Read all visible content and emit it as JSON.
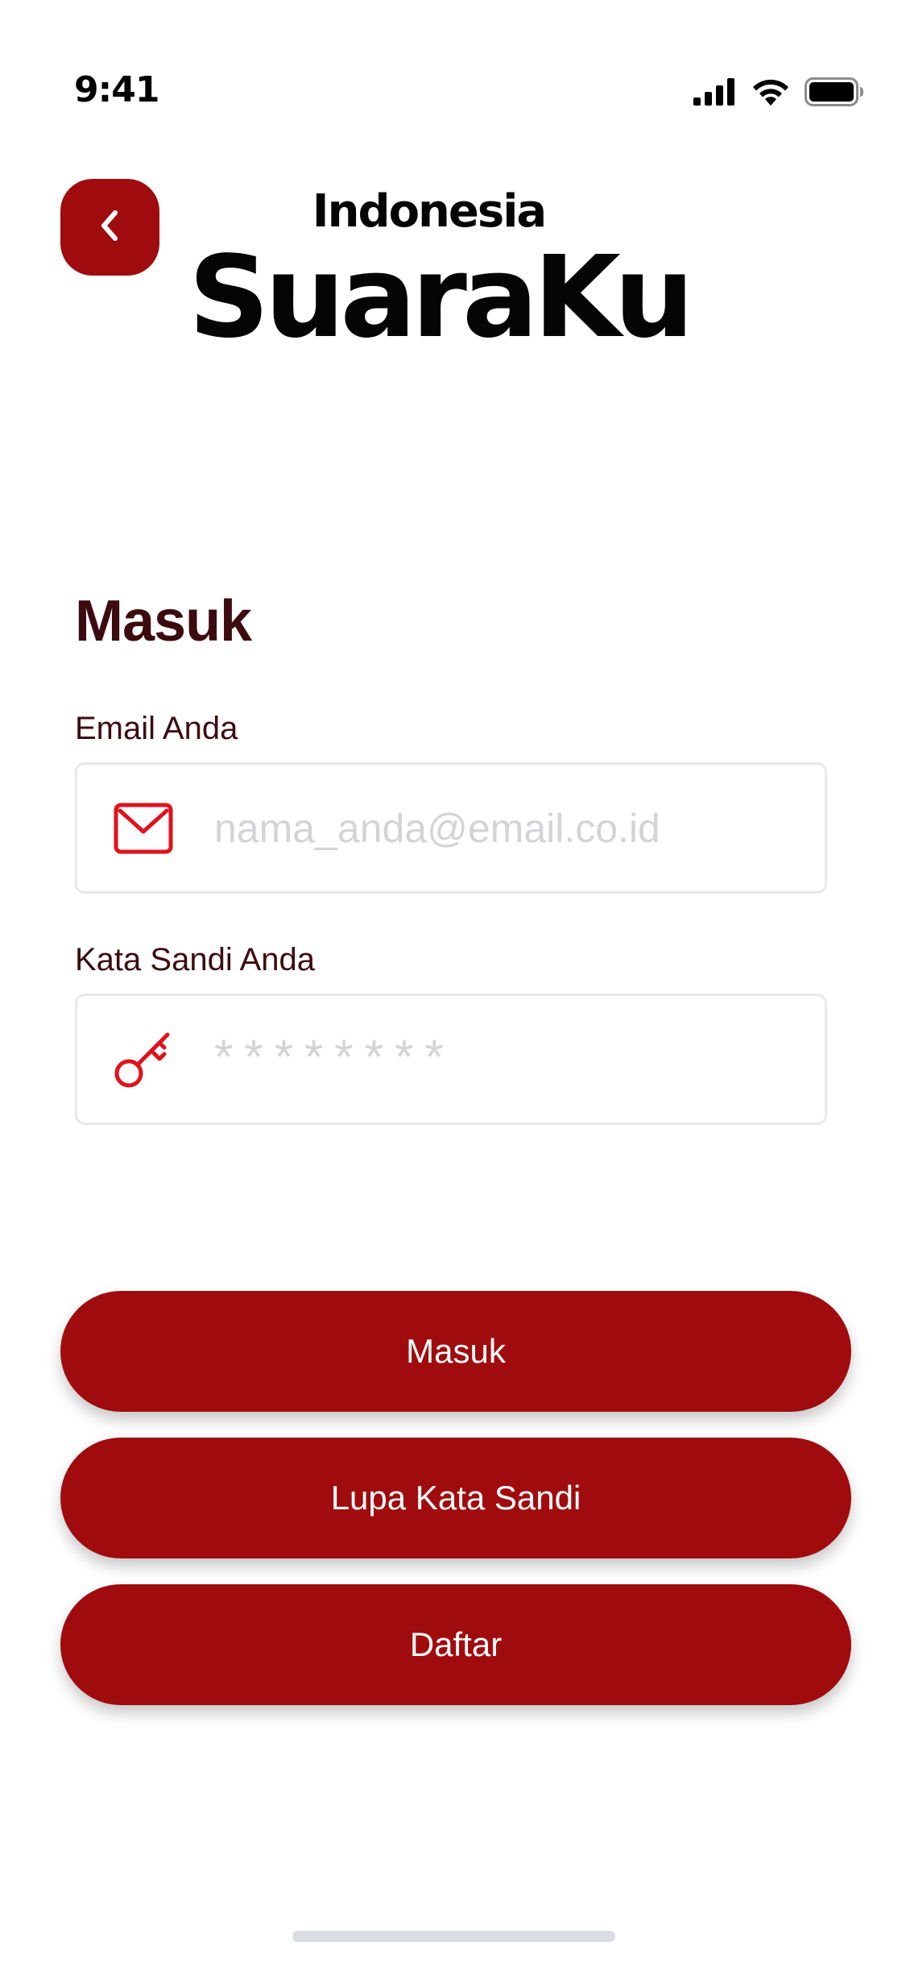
{
  "status_bar": {
    "time": "9:41",
    "icons": [
      "signal-icon",
      "wifi-icon",
      "battery-icon"
    ]
  },
  "header": {
    "back_icon": "chevron-left-icon",
    "brand_country": "Indonesia",
    "brand_name": "SuaraKu"
  },
  "form": {
    "title": "Masuk",
    "email": {
      "label": "Email Anda",
      "placeholder": "nama_anda@email.co.id",
      "value": "",
      "icon": "mail-icon"
    },
    "password": {
      "label": "Kata Sandi Anda",
      "placeholder": "********",
      "value": "",
      "icon": "key-icon"
    }
  },
  "buttons": {
    "login_label": "Masuk",
    "forgot_label": "Lupa Kata Sandi",
    "register_label": "Daftar"
  },
  "colors": {
    "accent": "#a00c0e",
    "text_dark": "#3c0b10",
    "icon_red": "#e3111c",
    "placeholder": "#d4d4d6",
    "field_border": "#e9e9ec"
  }
}
